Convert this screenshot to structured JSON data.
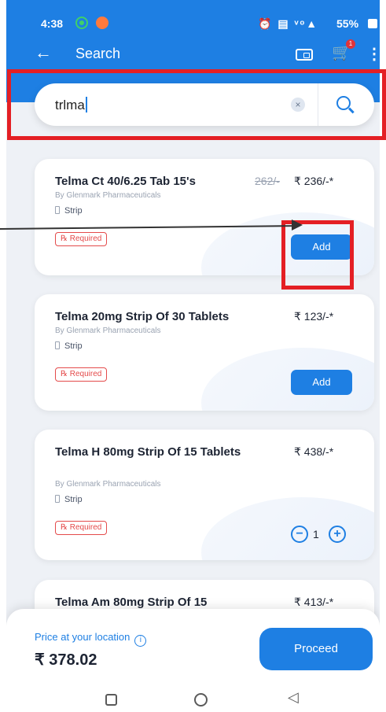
{
  "status_bar": {
    "time": "4:38",
    "right_icons": "⏰ ▤ ᵛᵒ▲",
    "battery": "55%"
  },
  "appbar": {
    "back_icon": "←",
    "title": "Search",
    "cart_count": "1",
    "more_icon": "⋮"
  },
  "search": {
    "query": "trlma",
    "clear_icon": "×"
  },
  "products": [
    {
      "name": "Telma Ct 40/6.25 Tab 15's",
      "old_price": "262/-",
      "price": "₹ 236/-*",
      "maker": "By Glenmark Pharmaceuticals",
      "pack": "Strip",
      "rx_label": "℞ Required",
      "action": "Add"
    },
    {
      "name": "Telma 20mg Strip Of 30 Tablets",
      "price": "₹ 123/-*",
      "maker": "By Glenmark Pharmaceuticals",
      "pack": "Strip",
      "rx_label": "℞ Required",
      "action": "Add"
    },
    {
      "name": "Telma H 80mg Strip Of 15 Tablets",
      "price": "₹ 438/-*",
      "maker": "By Glenmark Pharmaceuticals",
      "pack": "Strip",
      "rx_label": "℞ Required",
      "quantity": "1",
      "minus": "−",
      "plus": "+"
    },
    {
      "name": "Telma Am 80mg Strip Of 15",
      "price": "₹ 413/-*"
    }
  ],
  "footer": {
    "price_label": "Price at your location",
    "info_icon": "i",
    "total": "₹ 378.02",
    "proceed": "Proceed"
  },
  "nav": {
    "back_glyph": "◁"
  },
  "annotation_color": "#e41f24",
  "accent_color": "#1e7fe3"
}
